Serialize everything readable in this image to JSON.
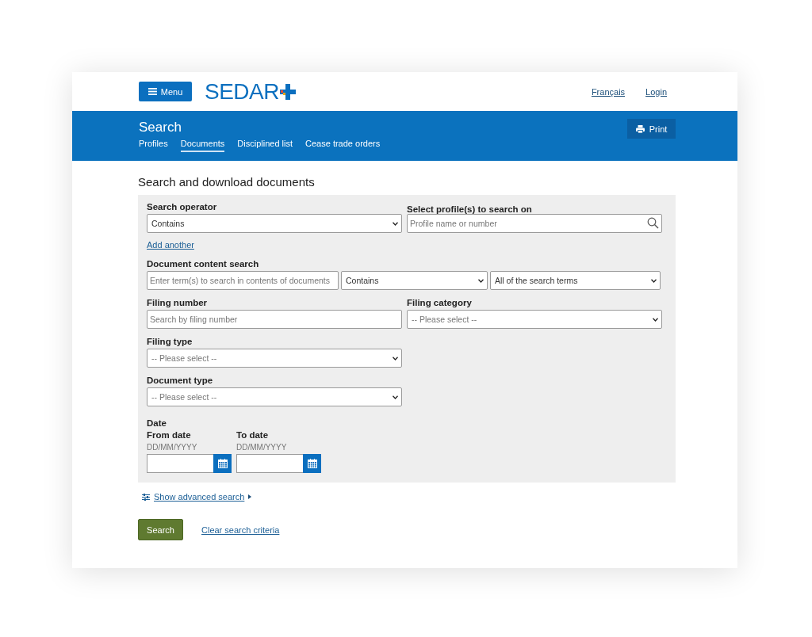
{
  "header": {
    "menu_button": "Menu",
    "logo": "SEDAR",
    "links": [
      "Français",
      "Login"
    ]
  },
  "banner": {
    "title": "Search",
    "print_button": "Print",
    "tabs": [
      {
        "label": "Profiles",
        "selected": false
      },
      {
        "label": "Documents",
        "selected": true
      },
      {
        "label": "Disciplined list",
        "selected": false
      },
      {
        "label": "Cease trade orders",
        "selected": false
      }
    ]
  },
  "heading": "Search and download documents",
  "form": {
    "search_operator": {
      "label": "Search operator",
      "value": "Contains"
    },
    "profile_search": {
      "label": "Select profile(s) to search on",
      "placeholder": "Profile name or number"
    },
    "add_another": "Add another",
    "content_search": {
      "label": "Document content search",
      "placeholder": "Enter term(s) to search in contents of documents",
      "operator": "Contains",
      "scope": "All of the search terms"
    },
    "filing_number": {
      "label": "Filing number",
      "placeholder": "Search by filing number"
    },
    "filing_category": {
      "label": "Filing category",
      "placeholder": "-- Please select --"
    },
    "filing_type": {
      "label": "Filing type",
      "placeholder": "-- Please select --"
    },
    "document_type": {
      "label": "Document type",
      "placeholder": "-- Please select --"
    },
    "date": {
      "label": "Date",
      "from": {
        "label": "From date",
        "hint": "DD/MM/YYYY"
      },
      "to": {
        "label": "To date",
        "hint": "DD/MM/YYYY"
      }
    }
  },
  "advanced_link": "Show advanced search",
  "actions": {
    "search_button": "Search",
    "clear_link": "Clear search criteria"
  }
}
